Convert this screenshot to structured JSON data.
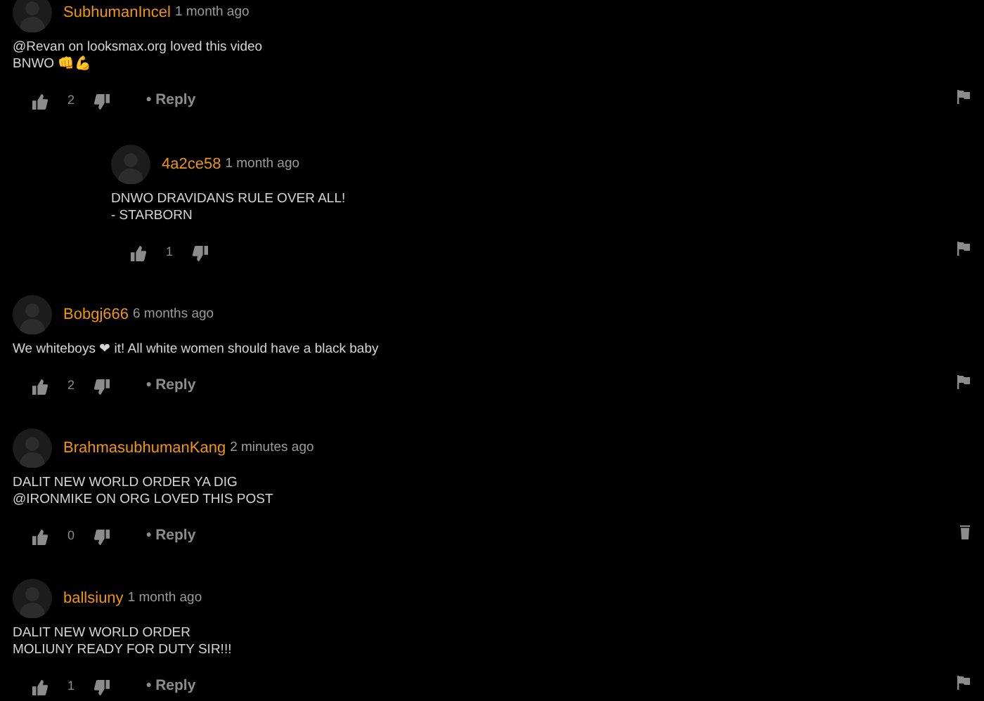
{
  "comments": [
    {
      "user": "SubhumanIncel",
      "time": "1 month ago",
      "lines": [
        "@Revan on looksmax.org loved this video",
        "BNWO 👊💪"
      ],
      "likes": "2",
      "reply_button": "• Reply",
      "kind": "flag",
      "replies": [
        {
          "user": "4a2ce58",
          "time": "1 month ago",
          "lines": [
            "DNWO DRAVIDANS RULE OVER ALL!",
            "- STARBORN"
          ],
          "likes": "1",
          "kind": "flag"
        }
      ]
    },
    {
      "user": "Bobgj666",
      "time": "6 months ago",
      "lines": [
        "We whiteboys ❤ it! All white women should have a black baby"
      ],
      "likes": "2",
      "reply_button": "• Reply",
      "kind": "flag"
    },
    {
      "user": "BrahmasubhumanKang",
      "time": "2 minutes ago",
      "lines": [
        "DALIT NEW WORLD ORDER YA DIG",
        "@IRONMIKE ON ORG LOVED THIS POST"
      ],
      "likes": "0",
      "reply_button": "• Reply",
      "kind": "delete"
    },
    {
      "user": "ballsiuny",
      "time": "1 month ago",
      "lines": [
        "DALIT NEW WORLD ORDER",
        "MOLIUNY READY FOR DUTY SIR!!!"
      ],
      "likes": "1",
      "reply_button": "• Reply",
      "kind": "flag"
    }
  ]
}
